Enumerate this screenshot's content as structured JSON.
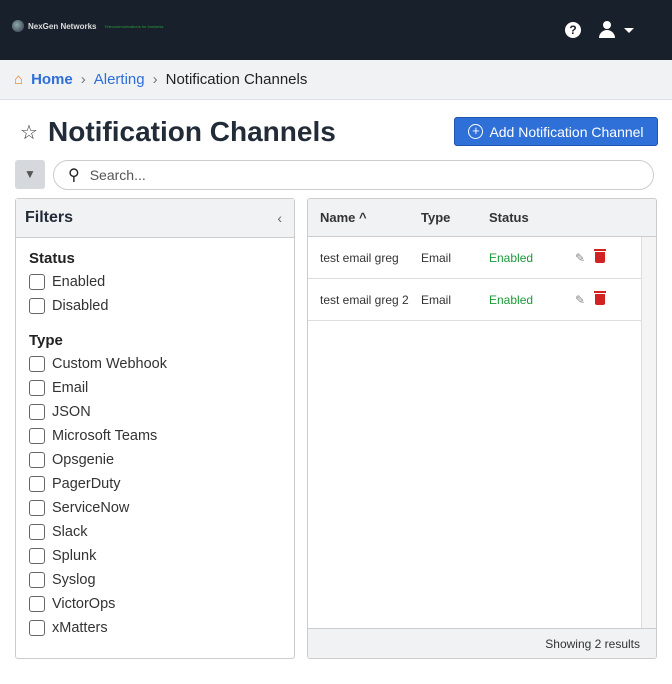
{
  "header": {
    "brand": "NexGen Networks",
    "tagline": "Telecommunications for business",
    "help": "?"
  },
  "breadcrumb": {
    "home": "Home",
    "alerting": "Alerting",
    "current": "Notification Channels"
  },
  "page": {
    "title": "Notification Channels",
    "add_label": "Add Notification Channel",
    "search_placeholder": "Search..."
  },
  "filters": {
    "title": "Filters",
    "collapse": "‹",
    "status_label": "Status",
    "status": [
      "Enabled",
      "Disabled"
    ],
    "type_label": "Type",
    "types": [
      "Custom Webhook",
      "Email",
      "JSON",
      "Microsoft Teams",
      "Opsgenie",
      "PagerDuty",
      "ServiceNow",
      "Slack",
      "Splunk",
      "Syslog",
      "VictorOps",
      "xMatters"
    ]
  },
  "table": {
    "columns": [
      "Name",
      "Type",
      "Status"
    ],
    "sort_indicator": "^",
    "rows": [
      {
        "name": "test email greg",
        "type": "Email",
        "status": "Enabled"
      },
      {
        "name": "test email greg 2",
        "type": "Email",
        "status": "Enabled"
      }
    ],
    "footer": "Showing 2 results"
  }
}
